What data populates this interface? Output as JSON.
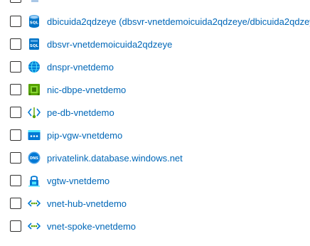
{
  "rows": [
    {
      "label": "dbicuida2qdzeye (dbsvr-vnetdemoicuida2qdzeye/dbicuida2qdzeye)",
      "icon": "sql-database-icon"
    },
    {
      "label": "dbsvr-vnetdemoicuida2qdzeye",
      "icon": "sql-server-icon"
    },
    {
      "label": "dnspr-vnetdemo",
      "icon": "dns-private-resolver-icon"
    },
    {
      "label": "nic-dbpe-vnetdemo",
      "icon": "network-interface-icon"
    },
    {
      "label": "pe-db-vnetdemo",
      "icon": "private-endpoint-icon"
    },
    {
      "label": "pip-vgw-vnetdemo",
      "icon": "public-ip-icon"
    },
    {
      "label": "privatelink.database.windows.net",
      "icon": "dns-zone-icon"
    },
    {
      "label": "vgtw-vnetdemo",
      "icon": "virtual-network-gateway-icon"
    },
    {
      "label": "vnet-hub-vnetdemo",
      "icon": "virtual-network-icon"
    },
    {
      "label": "vnet-spoke-vnetdemo",
      "icon": "virtual-network-icon"
    }
  ],
  "colors": {
    "link": "#0067b8",
    "checkbox_border": "#323130",
    "azure_blue": "#0078d4",
    "green": "#57a300",
    "light_blue": "#50e6ff"
  }
}
